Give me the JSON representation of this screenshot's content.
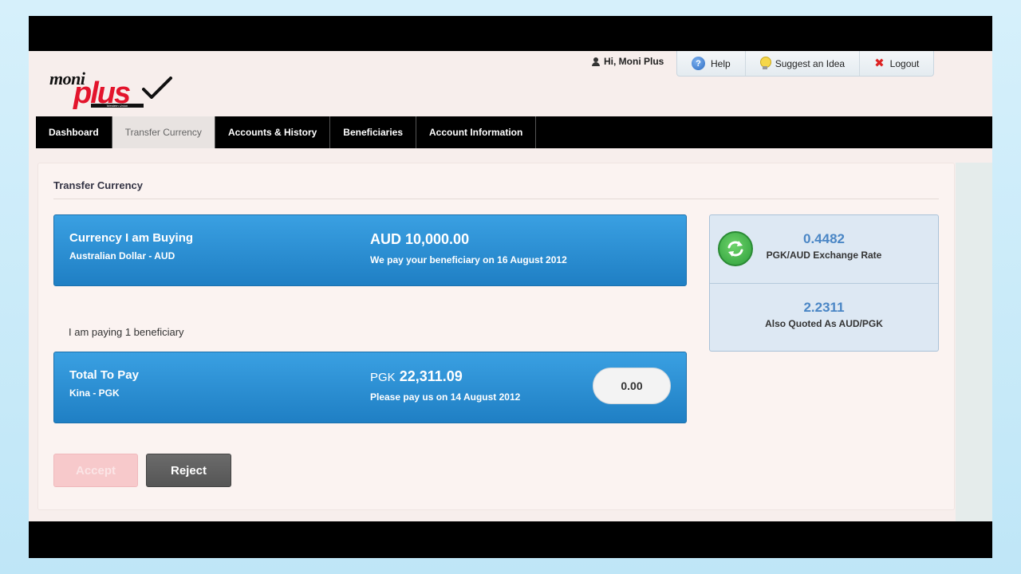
{
  "header": {
    "logo": {
      "moni": "moni",
      "plus": "plus",
      "tagline": "Western Union"
    },
    "greeting": "Hi, Moni Plus",
    "toolbar": {
      "help": "Help",
      "suggest": "Suggest an Idea",
      "logout": "Logout"
    }
  },
  "nav": {
    "items": [
      {
        "label": "Dashboard"
      },
      {
        "label": "Transfer Currency"
      },
      {
        "label": "Accounts & History"
      },
      {
        "label": "Beneficiaries"
      },
      {
        "label": "Account Information"
      }
    ],
    "active_index": 1
  },
  "panel": {
    "title": "Transfer Currency",
    "buying": {
      "title": "Currency I am Buying",
      "currency_name": "Australian Dollar - AUD",
      "amount": "AUD 10,000.00",
      "date_text": "We pay your beneficiary on 16 August 2012"
    },
    "beneficiary_text": "I am paying 1 beneficiary",
    "total": {
      "title": "Total To Pay",
      "currency_name": "Kina - PGK",
      "currency_code": "PGK",
      "amount": "22,311.09",
      "date_text": "Please pay us on 14 August 2012",
      "fee_value": "0.00"
    },
    "rates": {
      "primary_value": "0.4482",
      "primary_label": "PGK/AUD Exchange Rate",
      "secondary_value": "2.2311",
      "secondary_label": "Also Quoted As AUD/PGK"
    },
    "buttons": {
      "accept": "Accept",
      "reject": "Reject"
    }
  },
  "colors": {
    "accent_blue": "#2a8fd6",
    "brand_red": "#e3142c",
    "nav_black": "#000000",
    "rate_blue": "#4a86c5",
    "accept_disabled": "#f7c9cb",
    "reject_gray": "#606060"
  },
  "icons": {
    "user": "user-icon",
    "help": "help-icon",
    "suggest": "lightbulb-icon",
    "logout": "logout-x-icon",
    "refresh": "refresh-icon",
    "logo_tick": "checkmark-icon"
  }
}
